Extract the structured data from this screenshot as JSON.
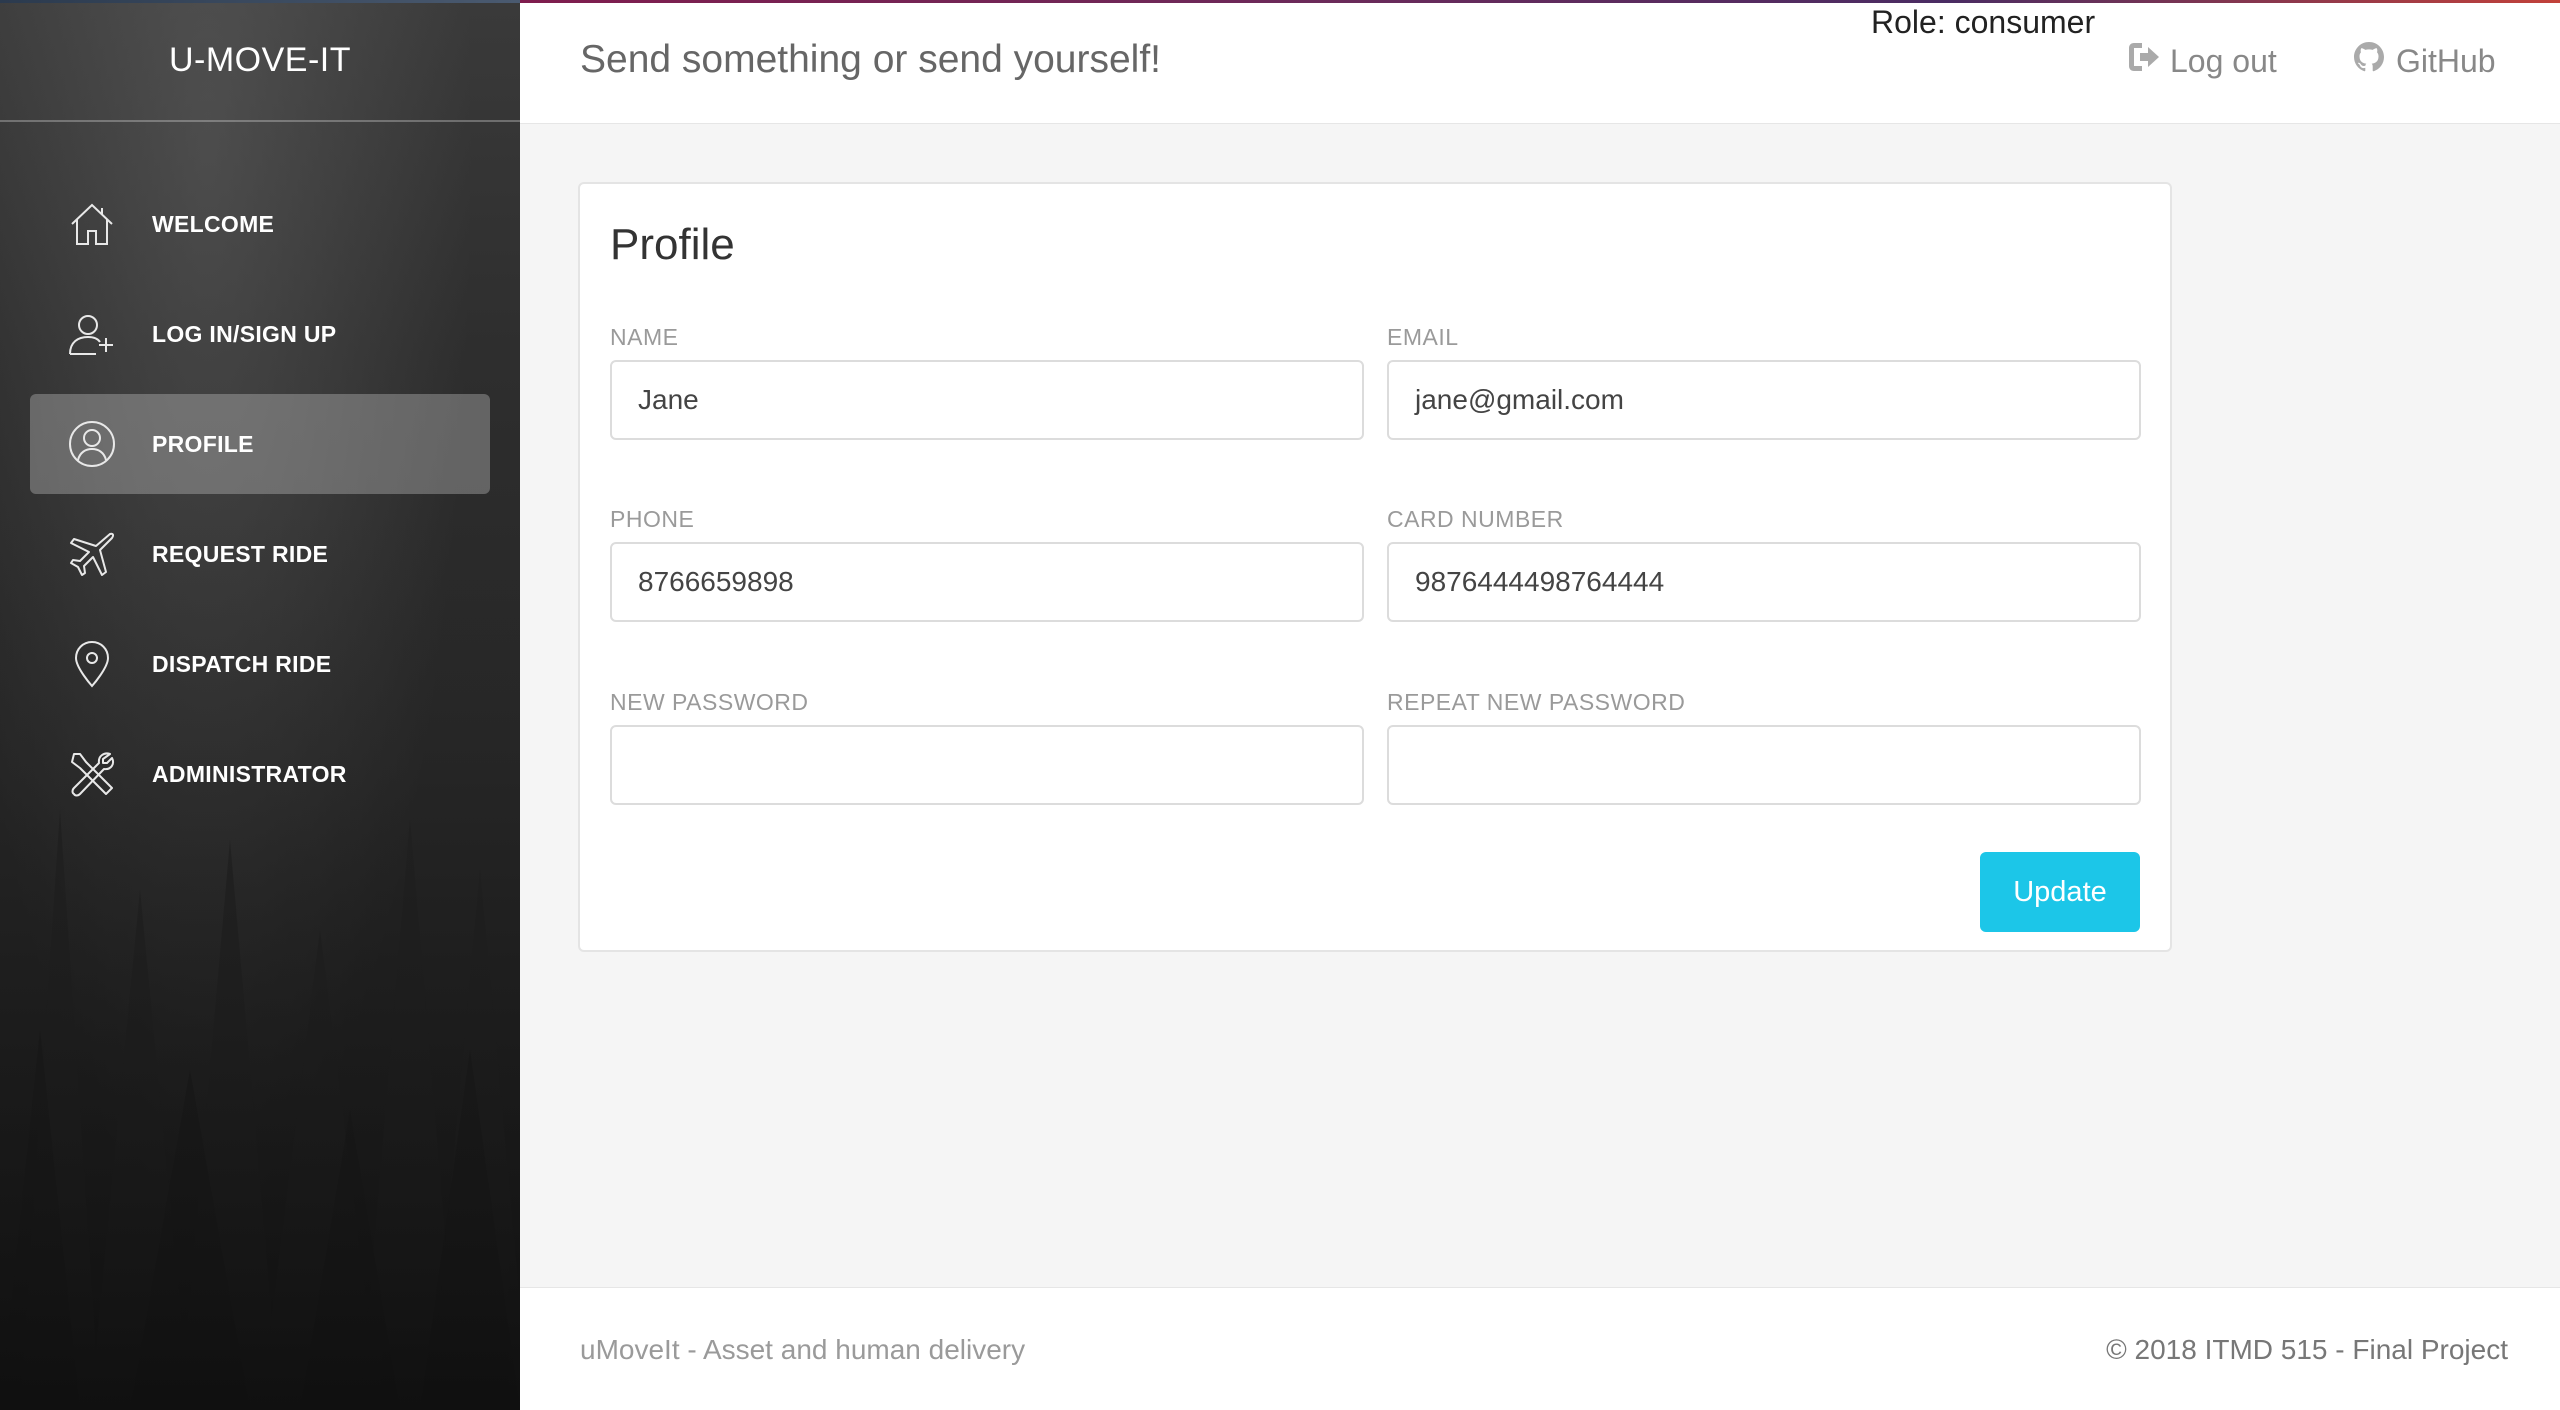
{
  "sidebar": {
    "brand": "U-MOVE-IT",
    "items": [
      {
        "label": "WELCOME",
        "icon": "home-icon"
      },
      {
        "label": "LOG IN/SIGN UP",
        "icon": "add-user-icon"
      },
      {
        "label": "PROFILE",
        "icon": "user-circle-icon",
        "active": true
      },
      {
        "label": "REQUEST RIDE",
        "icon": "airplane-icon"
      },
      {
        "label": "DISPATCH RIDE",
        "icon": "map-pin-icon"
      },
      {
        "label": "ADMINISTRATOR",
        "icon": "tools-icon"
      }
    ]
  },
  "header": {
    "title": "Send something or send yourself!",
    "role": "Role: consumer",
    "logout_label": "Log out",
    "github_label": "GitHub"
  },
  "profile": {
    "title": "Profile",
    "fields": {
      "name": {
        "label": "NAME",
        "value": "Jane"
      },
      "email": {
        "label": "EMAIL",
        "value": "jane@gmail.com"
      },
      "phone": {
        "label": "PHONE",
        "value": "8766659898"
      },
      "card": {
        "label": "CARD NUMBER",
        "value": "9876444498764444"
      },
      "new_password": {
        "label": "NEW PASSWORD",
        "value": ""
      },
      "repeat_password": {
        "label": "REPEAT NEW PASSWORD",
        "value": ""
      }
    },
    "update_label": "Update"
  },
  "footer": {
    "left": "uMoveIt - Asset and human delivery",
    "right": "© 2018 ITMD 515 - Final Project"
  },
  "colors": {
    "accent": "#1cc6e8",
    "sidebar_bg": "#262626",
    "active_item": "#5f5f5f"
  }
}
